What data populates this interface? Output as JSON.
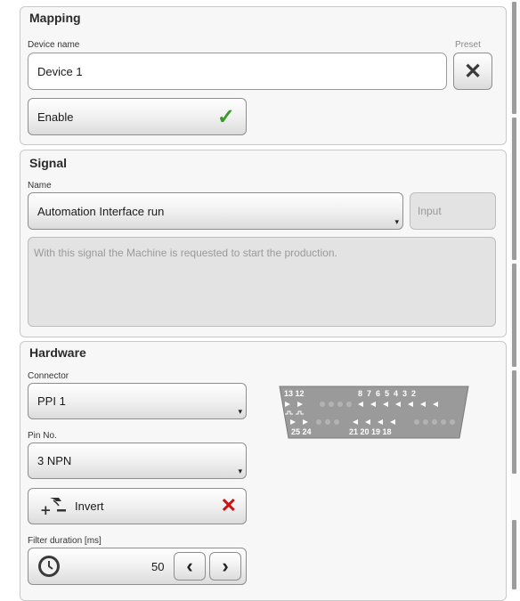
{
  "mapping": {
    "title": "Mapping",
    "device_name_label": "Device name",
    "device_name_value": "Device 1",
    "preset_label": "Preset",
    "enable_label": "Enable"
  },
  "signal": {
    "title": "Signal",
    "name_label": "Name",
    "name_value": "Automation Interface run",
    "type_value": "Input",
    "description": "With this signal the Machine is requested to start the production."
  },
  "hardware": {
    "title": "Hardware",
    "connector_label": "Connector",
    "connector_value": "PPI 1",
    "pin_label": "Pin No.",
    "pin_value": "3 NPN",
    "invert_label": "Invert",
    "filter_label": "Filter duration [ms]",
    "filter_value": "50",
    "connector_top_left_labels": "13 12",
    "connector_top_right_labels": "8  7  6  5  4  3  2",
    "connector_bottom_left_labels": "25 24",
    "connector_bottom_right_labels": "21 20 19 18"
  },
  "colors": {
    "check_green": "#3a9a2a",
    "cross_red": "#cc1111",
    "panel_bg": "#f7f7f7"
  }
}
